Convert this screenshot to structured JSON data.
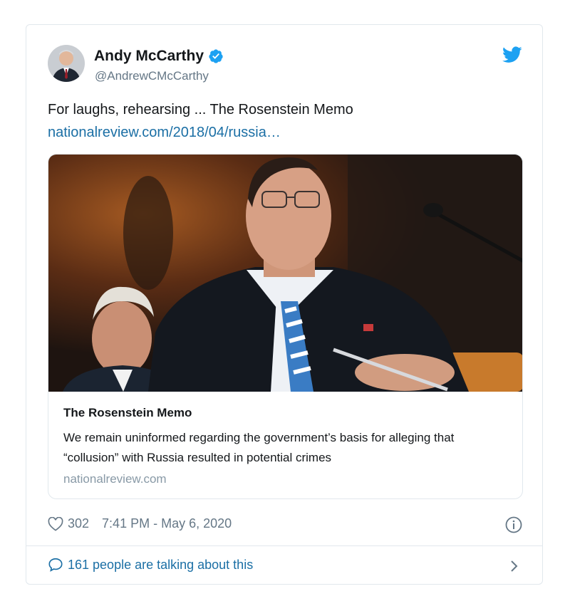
{
  "author": {
    "name": "Andy McCarthy",
    "handle": "@AndrewCMcCarthy",
    "verified": true
  },
  "tweet": {
    "text": "For laughs, rehearsing ... The Rosenstein Memo",
    "link": "nationalreview.com/2018/04/russia…"
  },
  "card": {
    "title": "The Rosenstein Memo",
    "description": "We remain uninformed regarding the government’s basis for alleging that “collusion” with Russia resulted in potential crimes",
    "domain": "nationalreview.com"
  },
  "meta": {
    "likes": "302",
    "timestamp": "7:41 PM - May 6, 2020"
  },
  "footer": {
    "talking": "161 people are talking about this"
  },
  "colors": {
    "twitter_blue": "#1da1f2",
    "link_blue": "#1b6fa5",
    "muted_gray": "#657786"
  },
  "icons": [
    "verified-badge-icon",
    "twitter-bird-icon",
    "heart-icon",
    "info-icon",
    "speech-bubble-icon",
    "chevron-right-icon"
  ]
}
